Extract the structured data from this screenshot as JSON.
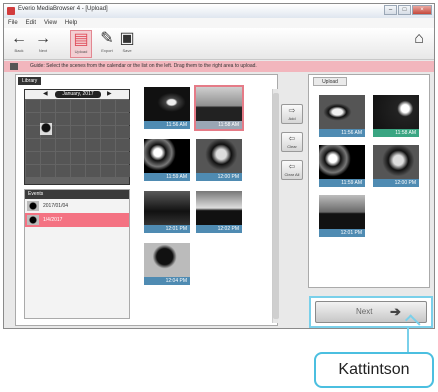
{
  "window": {
    "title": "Everio MediaBrowser 4 - [Upload]"
  },
  "menu": [
    "File",
    "Edit",
    "View",
    "Help"
  ],
  "toolbar": {
    "back": "Back",
    "forward": "Next",
    "active_label": "Upload",
    "export": "Export",
    "save": "Save"
  },
  "infobar": {
    "text": "Guide: Select the scenes from the calendar or the list on the left. Drag them to the right area to upload."
  },
  "left_tab": "Library",
  "calendar": {
    "month": "January, 2017",
    "days": [
      "",
      "",
      "",
      "",
      "",
      "",
      "",
      "",
      "",
      "",
      "",
      "",
      "",
      "",
      "",
      "",
      "",
      "",
      "",
      "",
      "",
      "",
      "",
      "",
      "",
      "",
      "",
      "",
      "",
      "",
      "",
      "",
      "",
      "",
      "",
      ""
    ]
  },
  "groups": {
    "header": "Events",
    "items": [
      {
        "label": "2017/01/04"
      },
      {
        "label": "1/4/2017"
      }
    ]
  },
  "thumbnails": [
    "11:56 AM",
    "11:58 AM",
    "11:59 AM",
    "12:00 PM",
    "12:01 PM",
    "12:02 PM",
    "12:04 PM"
  ],
  "mid_buttons": [
    {
      "label": "Add"
    },
    {
      "label": "Clear"
    },
    {
      "label": "Clear All"
    }
  ],
  "right_tab": "Upload",
  "right_thumbnails": [
    "11:56 AM",
    "11:58 AM",
    "11:59 AM",
    "12:00 PM",
    "12:01 PM"
  ],
  "next_button": {
    "label": "Next"
  },
  "callout": {
    "label": "Kattintson"
  }
}
